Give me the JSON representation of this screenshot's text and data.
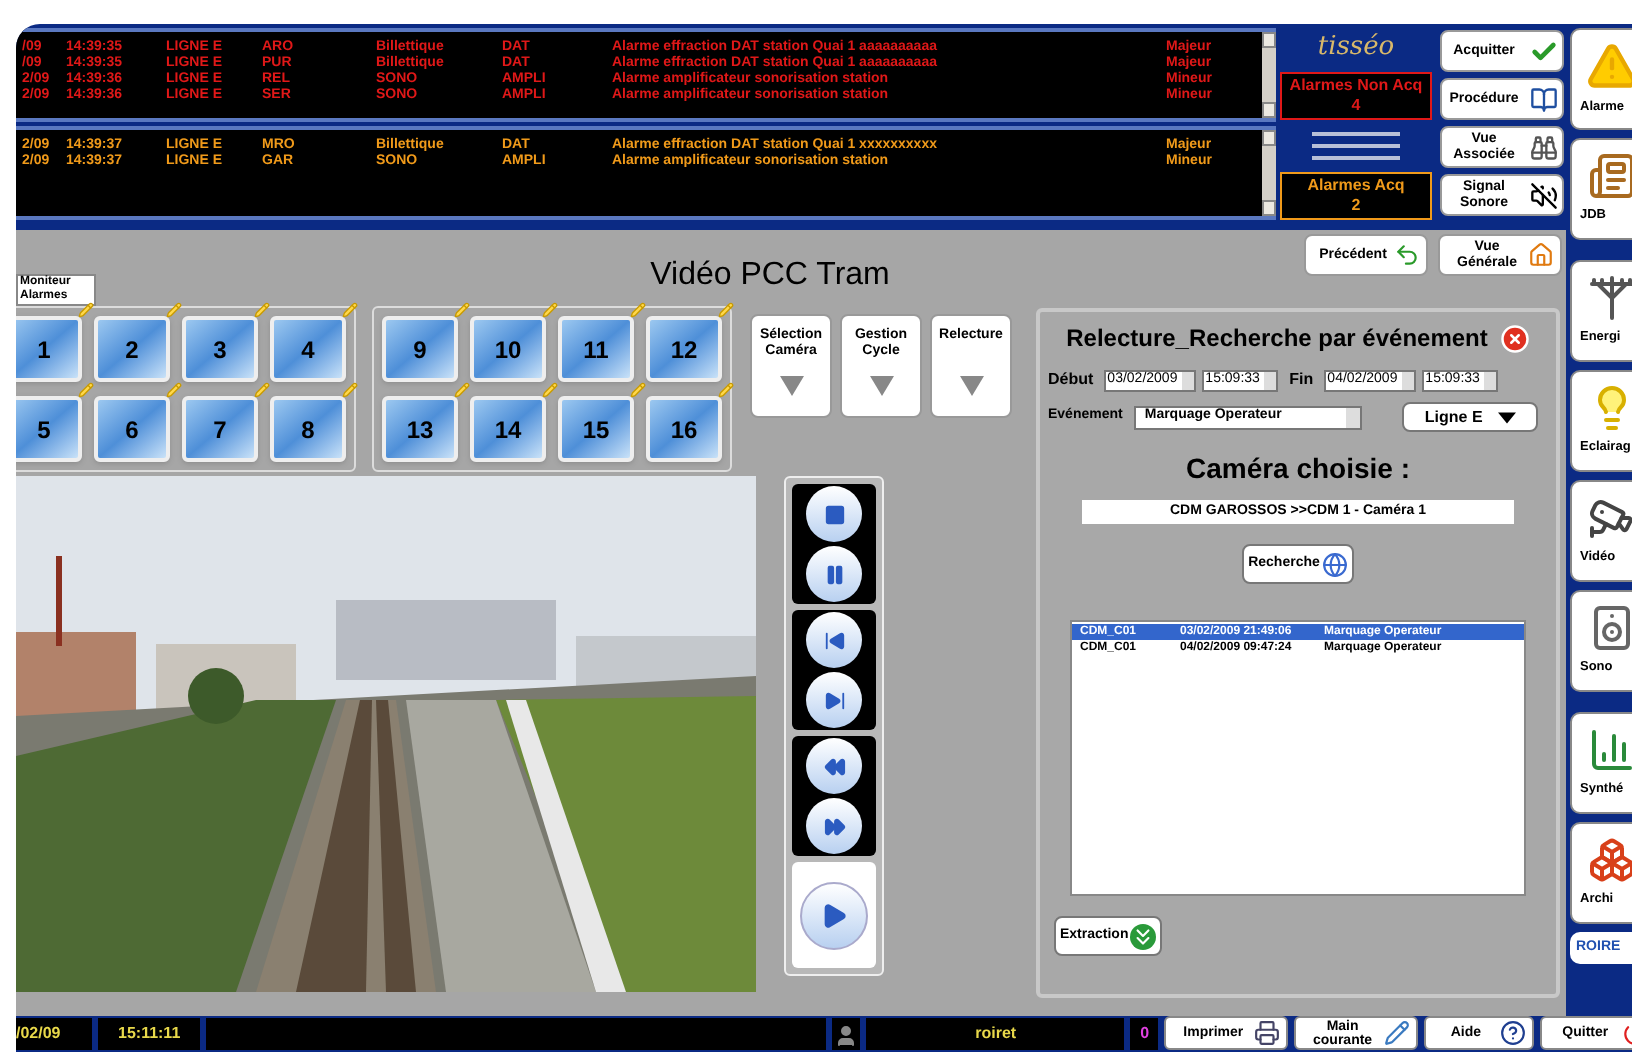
{
  "alarm_panels": [
    {
      "color": "#e01818",
      "rows": [
        {
          "cells": [
            "/09",
            "14:39:35",
            "LIGNE E",
            "ARO",
            "Billettique",
            "DAT",
            "Alarme  effraction DAT station Quai 1 aaaaaaaaaa",
            "Majeur"
          ]
        },
        {
          "cells": [
            "/09",
            "14:39:35",
            "LIGNE E",
            "PUR",
            "Billettique",
            "DAT",
            "Alarme  effraction DAT station Quai 1 aaaaaaaaaa",
            "Majeur"
          ]
        },
        {
          "cells": [
            "2/09",
            "14:39:36",
            "LIGNE E",
            "REL",
            "SONO",
            "AMPLI",
            "Alarme  amplificateur sonorisation station",
            "Mineur"
          ]
        },
        {
          "cells": [
            "2/09",
            "14:39:36",
            "LIGNE E",
            "SER",
            "SONO",
            "AMPLI",
            "Alarme  amplificateur sonorisation station",
            "Mineur"
          ]
        }
      ]
    },
    {
      "color": "#f09a1a",
      "rows": [
        {
          "cells": [
            "2/09",
            "14:39:37",
            "LIGNE E",
            "MRO",
            "Billettique",
            "DAT",
            "Alarme  effraction DAT station Quai 1 xxxxxxxxxx",
            "Majeur"
          ]
        },
        {
          "cells": [
            "2/09",
            "14:39:37",
            "LIGNE E",
            "GAR",
            "SONO",
            "AMPLI",
            "Alarme  amplificateur sonorisation station",
            "Mineur"
          ]
        }
      ]
    }
  ],
  "logo": "tisséo",
  "counters": [
    {
      "label": "Alarmes Non Acq",
      "value": "4",
      "color": "#e01818"
    },
    {
      "label": "Alarmes Acq",
      "value": "2",
      "color": "#f09a1a"
    }
  ],
  "alarm_buttons": [
    "Acquitter",
    "Procédure",
    "Vue Associée",
    "Signal Sonore"
  ],
  "sidebar": [
    {
      "label": "Alarme"
    },
    {
      "label": "JDB"
    },
    {
      "label": "Energi"
    },
    {
      "label": "Eclairag"
    },
    {
      "label": "Vidéo"
    },
    {
      "label": "Sono"
    },
    {
      "label": "Synthé"
    },
    {
      "label": "Archi"
    }
  ],
  "sidebar_logo": "ROIRE",
  "title": "Vidéo PCC Tram",
  "nav_buttons": [
    "Précédent",
    "Vue Générale"
  ],
  "monitor_label": "Moniteur Alarmes",
  "monitor_groups": [
    [
      "1",
      "2",
      "3",
      "4",
      "5",
      "6",
      "7",
      "8"
    ],
    [
      "9",
      "10",
      "11",
      "12",
      "13",
      "14",
      "15",
      "16"
    ]
  ],
  "mode_buttons": [
    "Sélection Caméra",
    "Gestion Cycle",
    "Relecture"
  ],
  "video": {
    "kind": "picture"
  },
  "relecture": {
    "title": "Relecture_Recherche par événement",
    "start_label": "Début",
    "start_date": "03/02/2009",
    "start_time": "15:09:33",
    "end_label": "Fin",
    "end_date": "04/02/2009",
    "end_time": "15:09:33",
    "event_label": "Evénement",
    "event_value": "Marquage Operateur",
    "line_value": "Ligne E",
    "camera_heading": "Caméra choisie :",
    "camera_value": "CDM GAROSSOS >>CDM 1 - Caméra 1",
    "search_button": "Recherche",
    "results": [
      {
        "camera": "CDM_C01",
        "datetime": "03/02/2009 21:49:06",
        "event": "Marquage Operateur",
        "selected": true
      },
      {
        "camera": "CDM_C01",
        "datetime": "04/02/2009 09:47:24",
        "event": "Marquage Operateur",
        "selected": false
      }
    ],
    "extract_button": "Extraction"
  },
  "status_bar": {
    "date": "/02/09",
    "time": "15:11:11",
    "user": "roiret",
    "count": "0",
    "buttons": [
      "Imprimer",
      "Main courante",
      "Aide",
      "Quitter"
    ]
  }
}
